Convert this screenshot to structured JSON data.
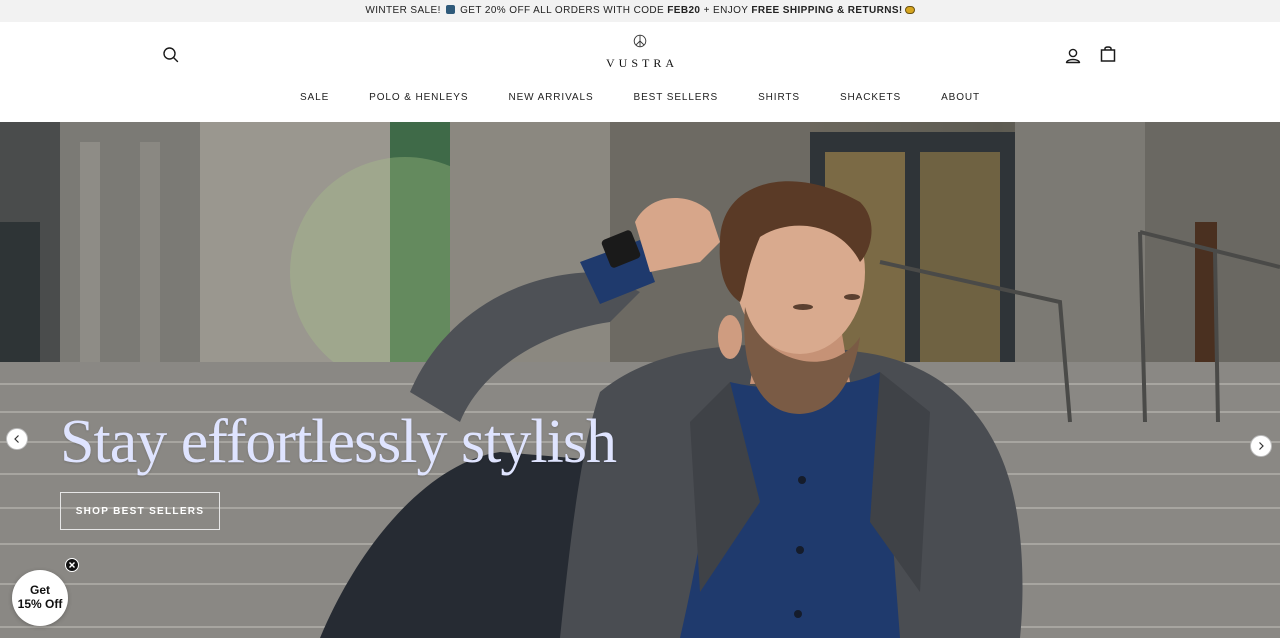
{
  "announcement": {
    "part1": "WINTER SALE!",
    "part2": "GET 20% OFF ALL ORDERS WITH CODE",
    "code": "FEB20",
    "part3": "+ ENJOY",
    "highlight": "FREE SHIPPING & RETURNS!"
  },
  "header": {
    "logo_text": "VUSTRA",
    "icons": {
      "search": "search-icon",
      "account": "account-icon",
      "cart": "shopping-bag-icon"
    }
  },
  "nav": {
    "items": [
      {
        "label": "SALE"
      },
      {
        "label": "POLO & HENLEYS"
      },
      {
        "label": "NEW ARRIVALS"
      },
      {
        "label": "BEST SELLERS"
      },
      {
        "label": "SHIRTS"
      },
      {
        "label": "SHACKETS"
      },
      {
        "label": "ABOUT"
      }
    ]
  },
  "hero": {
    "headline": "Stay effortlessly stylish",
    "cta_label": "SHOP BEST SELLERS",
    "headline_color": "#dfe4ff"
  },
  "discount_badge": {
    "line1": "Get",
    "line2": "15% Off"
  }
}
